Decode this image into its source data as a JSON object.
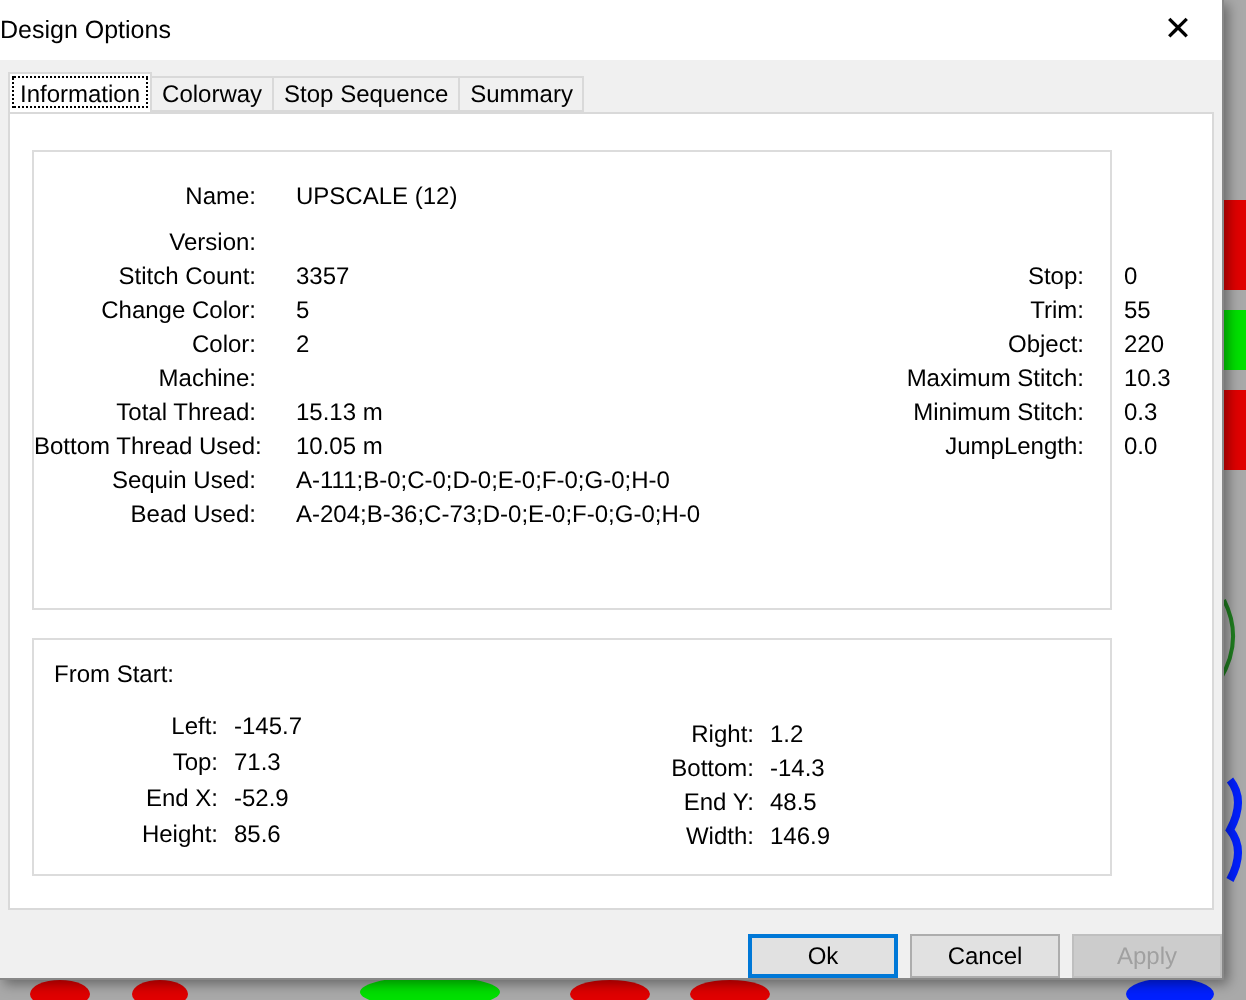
{
  "window": {
    "title": "Design Options",
    "close": "✕"
  },
  "tabs": [
    {
      "label": "Information",
      "selected": true
    },
    {
      "label": "Colorway",
      "selected": false
    },
    {
      "label": "Stop Sequence",
      "selected": false
    },
    {
      "label": "Summary",
      "selected": false
    }
  ],
  "info": {
    "rows": [
      {
        "label": "Name:",
        "value": "UPSCALE (12)"
      },
      {
        "label": "Version:"
      },
      {
        "label": "Stitch Count:",
        "value": "3357",
        "right_label": "Stop:",
        "right_value": "0"
      },
      {
        "label": "Change Color:",
        "value": "5",
        "right_label": "Trim:",
        "right_value": "55"
      },
      {
        "label": "Color:",
        "value": "2",
        "right_label": "Object:",
        "right_value": "220"
      },
      {
        "label": "Machine:",
        "right_label": "Maximum Stitch:",
        "right_value": "10.3"
      },
      {
        "label": "Total Thread:",
        "value": "15.13 m",
        "right_label": "Minimum Stitch:",
        "right_value": "0.3"
      },
      {
        "label": "Bottom Thread Used:",
        "value": "10.05 m",
        "right_label": "JumpLength:",
        "right_value": "0.0"
      },
      {
        "label": "Sequin Used:",
        "value": "A-111;B-0;C-0;D-0;E-0;F-0;G-0;H-0"
      },
      {
        "label": "Bead Used:",
        "value": "A-204;B-36;C-73;D-0;E-0;F-0;G-0;H-0"
      }
    ]
  },
  "from_start": {
    "title": "From Start:",
    "left": [
      {
        "label": "Left:",
        "value": "-145.7"
      },
      {
        "label": "Top:",
        "value": "71.3"
      },
      {
        "label": "End X:",
        "value": "-52.9"
      },
      {
        "label": "Height:",
        "value": "85.6"
      }
    ],
    "right": [
      {
        "label": "Right:",
        "value": "1.2"
      },
      {
        "label": "Bottom:",
        "value": "-14.3"
      },
      {
        "label": "End Y:",
        "value": "48.5"
      },
      {
        "label": "Width:",
        "value": "146.9"
      }
    ]
  },
  "buttons": [
    {
      "label": "Ok",
      "default": true,
      "disabled": false
    },
    {
      "label": "Cancel",
      "default": false,
      "disabled": false
    },
    {
      "label": "Apply",
      "default": false,
      "disabled": true
    }
  ]
}
